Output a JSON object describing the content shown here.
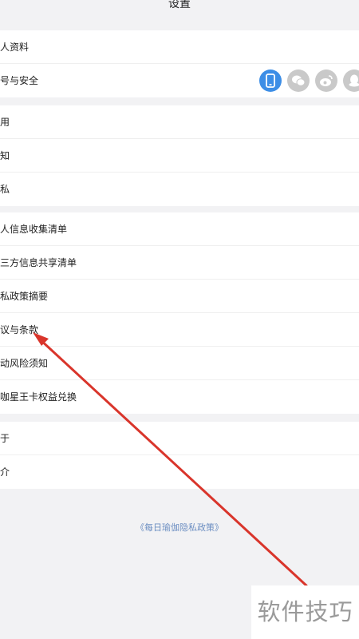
{
  "header": {
    "title": "设置"
  },
  "groups": [
    {
      "items": [
        "人资料",
        "号与安全"
      ]
    },
    {
      "items": [
        "用",
        "知",
        "私"
      ]
    },
    {
      "items": [
        "人信息收集清单",
        "三方信息共享清单",
        "私政策摘要",
        "议与条款",
        "动风险须知",
        "咖星王卡权益兑换"
      ]
    },
    {
      "items": [
        "于",
        "介"
      ]
    }
  ],
  "account_icons": [
    "phone-icon",
    "wechat-icon",
    "weibo-icon",
    "qq-icon"
  ],
  "footer": {
    "privacy_link": "《每日瑜伽隐私政策》"
  },
  "watermark": {
    "text": "软件技巧"
  },
  "colors": {
    "accent_blue": "#3d8ee6",
    "icon_gray": "#c9c9c9",
    "arrow_red": "#d9352b",
    "link_blue": "#6d8fc2"
  }
}
